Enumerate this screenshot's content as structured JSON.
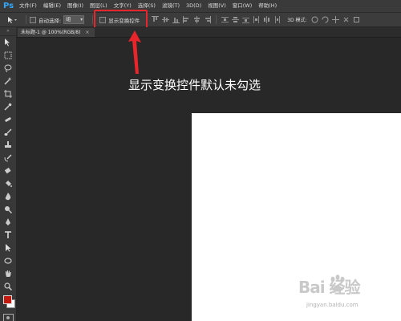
{
  "app": {
    "logo": "Ps",
    "accent": "#31a8ff"
  },
  "menubar": {
    "items": [
      "文件(F)",
      "编辑(E)",
      "图像(I)",
      "图层(L)",
      "文字(Y)",
      "选择(S)",
      "滤镜(T)",
      "3D(D)",
      "视图(V)",
      "窗口(W)",
      "帮助(H)"
    ]
  },
  "options_bar": {
    "auto_select_label": "自动选择:",
    "auto_select_value": "组",
    "show_transform_label": "显示变换控件",
    "mode_label": "3D 模式:",
    "highlight_color": "#e8252a"
  },
  "document": {
    "tab_title": "未标题-1 @ 100%(RGB/8)",
    "close_glyph": "×"
  },
  "annotation": {
    "text": "显示变换控件默认未勾选",
    "color": "#e8252a"
  },
  "colors": {
    "foreground": "#c4190f",
    "background": "#ffffff"
  },
  "watermark": {
    "main": "Bai 经验",
    "sub": "jingyan.baidu.com"
  }
}
